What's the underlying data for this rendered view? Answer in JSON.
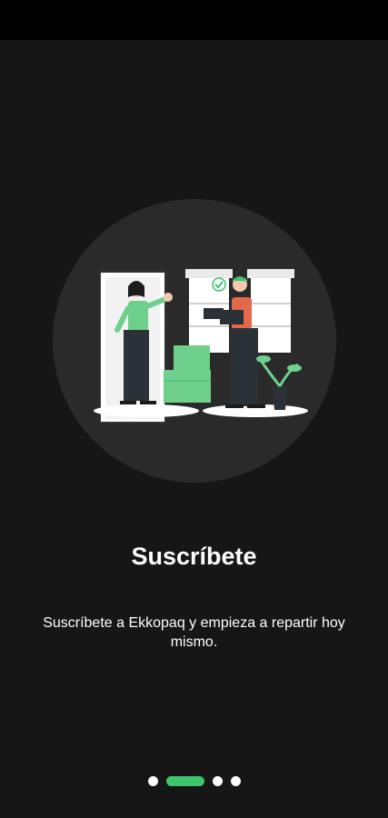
{
  "onboarding": {
    "illustration": "delivery-handoff-illustration",
    "title": "Suscríbete",
    "description": "Suscríbete a Ekkopaq y empieza a repartir hoy mismo.",
    "pager": {
      "total": 4,
      "active": 2
    }
  },
  "colors": {
    "background": "#161616",
    "accent": "#3ec46d",
    "circle": "#2a2a2a"
  }
}
